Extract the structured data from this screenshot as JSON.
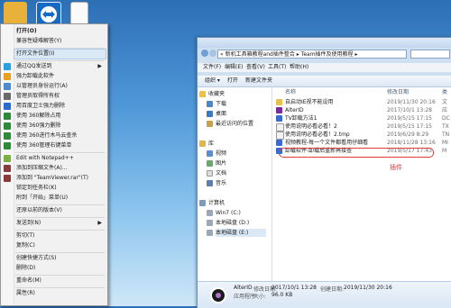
{
  "context_menu": {
    "items": [
      {
        "label": "打开(O)",
        "bold": true
      },
      {
        "label": "兼容性疑难解答(Y)"
      },
      {
        "label": "打开文件位置(I)",
        "highlight": true
      },
      {
        "label": "通过QQ发送到"
      },
      {
        "label": "强力卸载此软件"
      },
      {
        "label": "以管理员身份运行(A)"
      },
      {
        "label": "管理员取得所有权"
      },
      {
        "label": "用百度卫士强力删除"
      },
      {
        "label": "使用 360解除占用"
      },
      {
        "label": "使用 360强力删除"
      },
      {
        "label": "使用 360进行木马云查杀"
      },
      {
        "label": "使用 360管理右键菜单"
      },
      {
        "label": "Edit with Notepad++"
      },
      {
        "label": "添加到压缩文件(A)..."
      },
      {
        "label": "添加到 \"TeamViewer.rar\"(T)"
      },
      {
        "label": "锁定到任务栏(K)"
      },
      {
        "label": "附到「开始」菜单(U)"
      },
      {
        "label": "还原以前的版本(V)"
      },
      {
        "label": "发送到(N)"
      },
      {
        "label": "剪切(T)"
      },
      {
        "label": "复制(C)"
      },
      {
        "label": "创建快捷方式(S)"
      },
      {
        "label": "删除(D)"
      },
      {
        "label": "重命名(M)"
      },
      {
        "label": "属性(R)"
      }
    ],
    "submenu_arrow": "▶"
  },
  "explorer": {
    "breadcrumb": "«  新机工具箱教程and插件整合 ▸ Team插件及使用教程 ▸",
    "menu": [
      "文件(F)",
      "编辑(E)",
      "查看(V)",
      "工具(T)",
      "帮助(H)"
    ],
    "toolbar": [
      "组织 ▾",
      "打开",
      "新建文件夹"
    ],
    "nav": {
      "favorites": "收藏夹",
      "fav_items": [
        "下载",
        "桌面",
        "最近访问的位置"
      ],
      "libraries": "库",
      "lib_items": [
        "视频",
        "图片",
        "文档",
        "音乐"
      ],
      "computer": "计算机",
      "drives": [
        "Win7 (C:)",
        "本地磁盘 (D:)",
        "本地磁盘 (E:)"
      ]
    },
    "columns": {
      "name": "名称",
      "date": "修改日期",
      "type": "类"
    },
    "files": [
      {
        "name": "自启动IE视不能设用",
        "date": "2019/11/30 20:16",
        "type": "文"
      },
      {
        "name": "AlterID",
        "date": "2017/10/1 13:28",
        "type": "应"
      },
      {
        "name": "TV卸载方法1",
        "date": "2019/5/15 17:15",
        "type": "DC"
      },
      {
        "name": "使用说明必看必看！2",
        "date": "2019/5/15 17:15",
        "type": "TX"
      },
      {
        "name": "使用说明必看必看！2.tmp",
        "date": "2019/6/29 8:29",
        "type": "TN"
      },
      {
        "name": "视频教程-每一个文件都看用仔细看",
        "date": "2018/11/28 13:16",
        "type": "MI"
      },
      {
        "name": "卸载软件-卸载后重新再接查",
        "date": "2019/5/17 17:43",
        "type": "M"
      }
    ],
    "annotation": "插件",
    "status": {
      "name": "AlterID",
      "modified_label": "修改日期:",
      "modified": "2017/10/1 13:28",
      "created_label": "创建日期:",
      "created": "2019/11/30 20:16",
      "type": "应用程序",
      "size_label": "大小:",
      "size": "96.0 KB"
    }
  }
}
